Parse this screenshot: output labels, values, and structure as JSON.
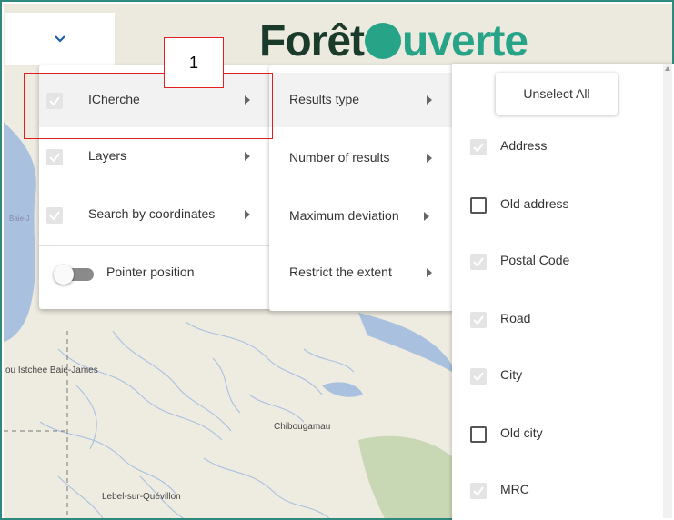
{
  "logo": {
    "prefix": "Forêt",
    "suffix": "uverte"
  },
  "map_labels": {
    "baie_left": "Baie-J",
    "eeyou": "ou Istchee Baie-James",
    "chibougamau": "Chibougamau",
    "lebel": "Lebel-sur-Quévillon"
  },
  "menu1": {
    "items": [
      {
        "label": "ICherche"
      },
      {
        "label": "Layers"
      },
      {
        "label": "Search by coordinates"
      },
      {
        "label": "Pointer position"
      }
    ]
  },
  "menu2": {
    "items": [
      {
        "label": "Results type"
      },
      {
        "label": "Number of results"
      },
      {
        "label": "Maximum deviation"
      },
      {
        "label": "Restrict the extent"
      }
    ]
  },
  "menu3": {
    "unselect_label": "Unselect All",
    "items": [
      {
        "label": "Address",
        "checked": true
      },
      {
        "label": "Old address",
        "checked": false
      },
      {
        "label": "Postal Code",
        "checked": true
      },
      {
        "label": "Road",
        "checked": true
      },
      {
        "label": "City",
        "checked": true
      },
      {
        "label": "Old city",
        "checked": false
      },
      {
        "label": "MRC",
        "checked": true
      }
    ]
  },
  "annotation": {
    "number": "1"
  },
  "colors": {
    "frame": "#2f8a7d",
    "brand_green": "#27a388",
    "annotation": "#e02020"
  }
}
